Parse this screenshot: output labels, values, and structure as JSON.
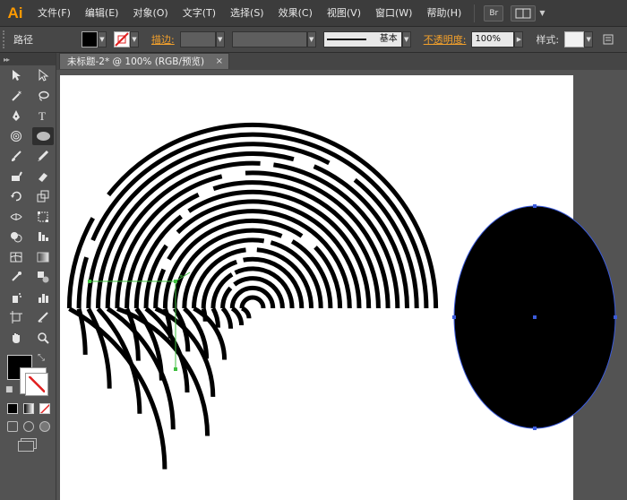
{
  "app": {
    "logo": "Ai"
  },
  "menu": {
    "items": [
      "文件(F)",
      "编辑(E)",
      "对象(O)",
      "文字(T)",
      "选择(S)",
      "效果(C)",
      "视图(V)",
      "窗口(W)",
      "帮助(H)"
    ],
    "bridge_label": "Br"
  },
  "control": {
    "object_type": "路径",
    "stroke_label": "描边:",
    "stroke_style": "基本",
    "opacity_label": "不透明度:",
    "opacity_value": "100%",
    "style_label": "样式:"
  },
  "document": {
    "tab_title": "未标题-2* @ 100% (RGB/预览)",
    "close_glyph": "×"
  },
  "tools": {
    "selected": "ellipse-tool"
  },
  "colors": {
    "fill": "#000000",
    "stroke": "none",
    "selection": "#3b5bdb",
    "guide": "#3fbf3f",
    "accent": "#f4a12b"
  }
}
